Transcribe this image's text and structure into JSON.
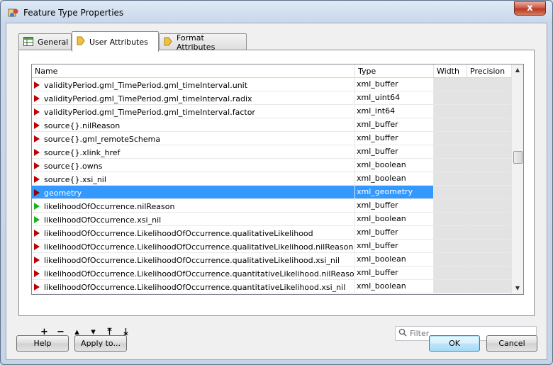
{
  "window": {
    "title": "Feature Type Properties",
    "close_glyph": "x"
  },
  "tabs": [
    {
      "label": "General",
      "icon": "general-grid-icon"
    },
    {
      "label": "User Attributes",
      "icon": "attribute-tag-icon",
      "active": true
    },
    {
      "label": "Format Attributes",
      "icon": "attribute-tag-icon"
    }
  ],
  "grid": {
    "columns": [
      "Name",
      "Type",
      "Width",
      "Precision"
    ],
    "rows": [
      {
        "name": "validityPeriod.gml_TimePeriod.gml_timeInterval.unit",
        "type": "xml_buffer",
        "marker": "red"
      },
      {
        "name": "validityPeriod.gml_TimePeriod.gml_timeInterval.radix",
        "type": "xml_uint64",
        "marker": "red"
      },
      {
        "name": "validityPeriod.gml_TimePeriod.gml_timeInterval.factor",
        "type": "xml_int64",
        "marker": "red"
      },
      {
        "name": "source{}.nilReason",
        "type": "xml_buffer",
        "marker": "red"
      },
      {
        "name": "source{}.gml_remoteSchema",
        "type": "xml_buffer",
        "marker": "red"
      },
      {
        "name": "source{}.xlink_href",
        "type": "xml_buffer",
        "marker": "red"
      },
      {
        "name": "source{}.owns",
        "type": "xml_boolean",
        "marker": "red"
      },
      {
        "name": "source{}.xsi_nil",
        "type": "xml_boolean",
        "marker": "red"
      },
      {
        "name": "geometry",
        "type": "xml_geometry",
        "marker": "dark",
        "selected": true
      },
      {
        "name": "likelihoodOfOccurrence.nilReason",
        "type": "xml_buffer",
        "marker": "green"
      },
      {
        "name": "likelihoodOfOccurrence.xsi_nil",
        "type": "xml_boolean",
        "marker": "green"
      },
      {
        "name": "likelihoodOfOccurrence.LikelihoodOfOccurrence.qualitativeLikelihood",
        "type": "xml_buffer",
        "marker": "red"
      },
      {
        "name": "likelihoodOfOccurrence.LikelihoodOfOccurrence.qualitativeLikelihood.nilReason",
        "type": "xml_buffer",
        "marker": "red"
      },
      {
        "name": "likelihoodOfOccurrence.LikelihoodOfOccurrence.qualitativeLikelihood.xsi_nil",
        "type": "xml_boolean",
        "marker": "red"
      },
      {
        "name": "likelihoodOfOccurrence.LikelihoodOfOccurrence.quantitativeLikelihood.nilReason",
        "type": "xml_buffer",
        "marker": "red"
      },
      {
        "name": "likelihoodOfOccurrence.LikelihoodOfOccurrence.quantitativeLikelihood.xsi_nil",
        "type": "xml_boolean",
        "marker": "red"
      }
    ]
  },
  "toolbar": {
    "add": "+",
    "remove": "−",
    "move_up": "▴",
    "move_down": "▾",
    "move_top": "⤒",
    "move_bottom": "⤓"
  },
  "filter": {
    "placeholder": "Filter",
    "value": ""
  },
  "buttons": {
    "help": "Help",
    "apply": "Apply to...",
    "ok": "OK",
    "cancel": "Cancel"
  },
  "colors": {
    "selection": "#3399ff",
    "marker_red": "#c00000",
    "marker_green": "#19b419"
  }
}
